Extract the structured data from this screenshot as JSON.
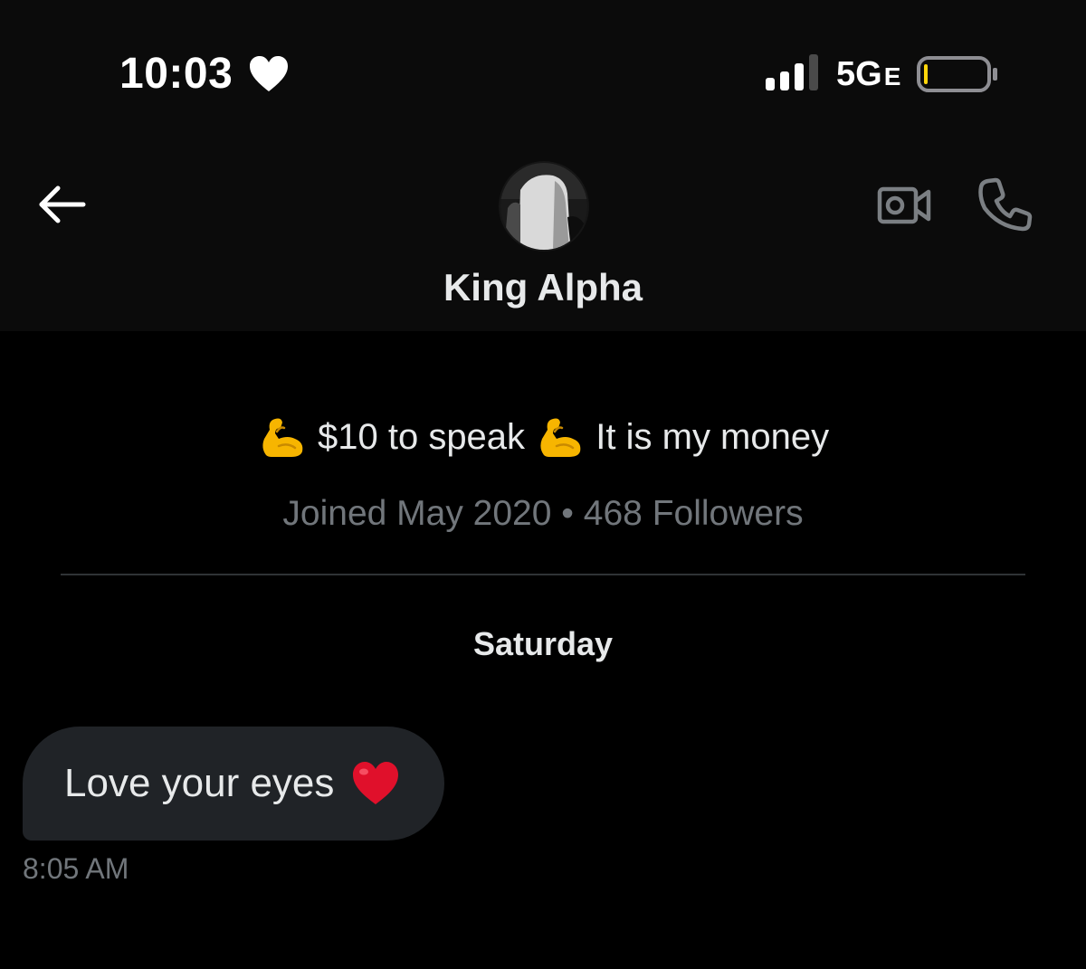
{
  "status_bar": {
    "time": "10:03",
    "network": "5G",
    "network_suffix": "E",
    "signal_bars_filled": 3,
    "signal_bars_total": 4,
    "battery_level": 0.05,
    "icons": [
      "heart-icon",
      "signal-icon",
      "battery-icon"
    ]
  },
  "header": {
    "contact_name": "King Alpha",
    "icons": [
      "back-arrow-icon",
      "video-camera-icon",
      "phone-icon"
    ]
  },
  "profile": {
    "bio_part1": " $10 to speak ",
    "bio_part2": " It is my money",
    "bio_emoji": "flexed-biceps",
    "joined": "Joined May 2020",
    "separator": "•",
    "followers": "468 Followers"
  },
  "conversation": {
    "day_label": "Saturday",
    "messages": [
      {
        "text": "Love your eyes",
        "emoji": "red-heart",
        "time": "8:05 AM"
      }
    ]
  },
  "colors": {
    "background": "#000000",
    "header_bg": "#0b0b0b",
    "text_primary": "#e7e9ea",
    "text_secondary": "#71767b",
    "bubble_bg": "#202327",
    "divider": "#2f3336",
    "battery_low": "#ffd60a",
    "emoji_yellow": "#f7b500",
    "heart_red": "#e0102b"
  }
}
